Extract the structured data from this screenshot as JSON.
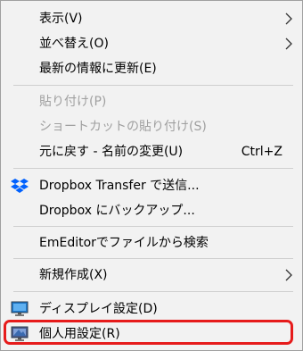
{
  "menu": {
    "items": {
      "view": {
        "label": "表示(V)"
      },
      "sort": {
        "label": "並べ替え(O)"
      },
      "refresh": {
        "label": "最新の情報に更新(E)"
      },
      "paste": {
        "label": "貼り付け(P)"
      },
      "paste_shortcut": {
        "label": "ショートカットの貼り付け(S)"
      },
      "undo": {
        "label": "元に戻す - 名前の変更(U)",
        "shortcut": "Ctrl+Z"
      },
      "dropbox_transfer": {
        "label": "Dropbox Transfer で送信..."
      },
      "dropbox_backup": {
        "label": "Dropbox にバックアップ..."
      },
      "emeditor_search": {
        "label": "EmEditorでファイルから検索"
      },
      "new": {
        "label": "新規作成(X)"
      },
      "display_settings": {
        "label": "ディスプレイ設定(D)"
      },
      "personalize": {
        "label": "個人用設定(R)"
      }
    },
    "highlighted_item": "personalize"
  },
  "colors": {
    "menu_background": "#f2f2f2",
    "disabled_text": "#a0a0a0",
    "highlight_border": "#e61b1b",
    "dropbox_blue": "#0061fe"
  },
  "icons": {
    "dropbox": "dropbox-icon",
    "display": "display-monitor-icon",
    "personalize": "personalize-monitor-icon",
    "submenu": "chevron-right-icon"
  }
}
